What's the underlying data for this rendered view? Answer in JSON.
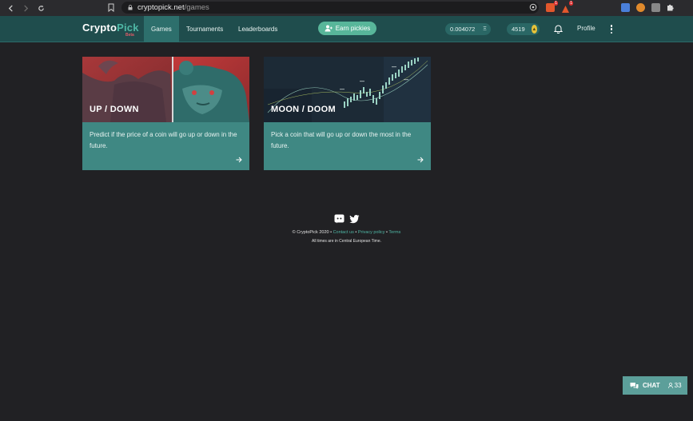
{
  "browser": {
    "url_domain": "cryptopick.net",
    "url_path": "/games",
    "extension_badges": [
      "1",
      "1"
    ]
  },
  "header": {
    "logo_crypto": "Crypto",
    "logo_pick": "Pick",
    "logo_beta": "Beta",
    "nav": [
      {
        "label": "Games",
        "active": true
      },
      {
        "label": "Tournaments",
        "active": false
      },
      {
        "label": "Leaderboards",
        "active": false
      }
    ],
    "earn_label": "Earn pickies",
    "eth_balance": "0.004072",
    "eth_symbol": "Ξ",
    "pickies_balance": "4519",
    "profile_label": "Profile"
  },
  "games": [
    {
      "title": "UP / DOWN",
      "description": "Predict if the price of a coin will go up or down in the future."
    },
    {
      "title": "MOON / DOOM",
      "description": "Pick a coin that will go up or down the most in the future."
    }
  ],
  "footer": {
    "copyright": "© CryptoPick 2020",
    "links": [
      "Contact us",
      "Privacy policy",
      "Terms"
    ],
    "separator": "•",
    "timezone_note": "All times are in Central European Time."
  },
  "chat": {
    "label": "CHAT",
    "online_count": "33"
  },
  "colors": {
    "background": "#212124",
    "header": "#1f4d4d",
    "accent": "#4fb7a5",
    "card_body": "#3f8883"
  }
}
